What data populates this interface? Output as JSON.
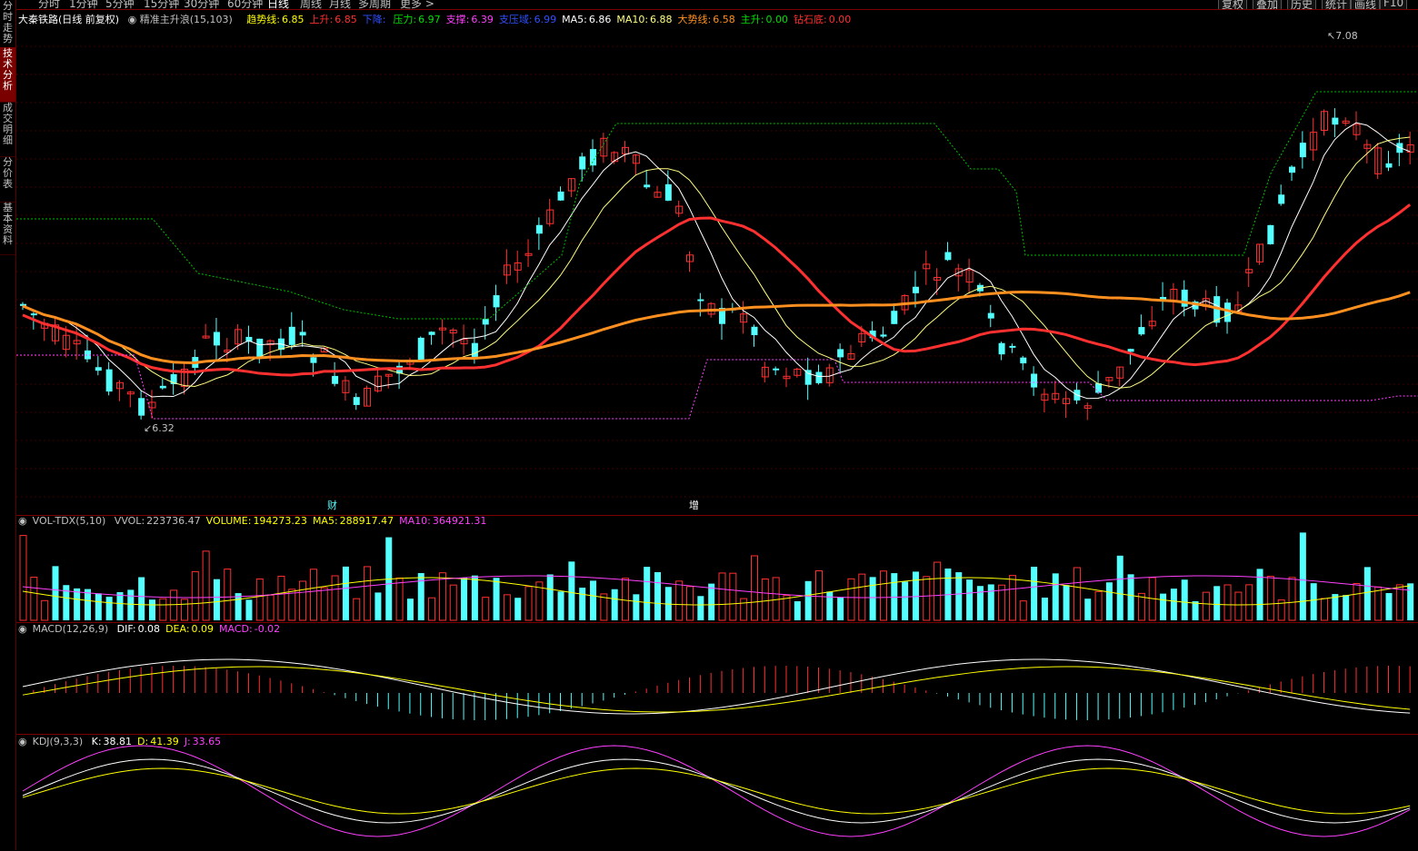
{
  "sidebar": {
    "tabs": [
      {
        "label": "分时走势",
        "active": false
      },
      {
        "label": "技术分析",
        "active": true
      },
      {
        "label": "成交明细",
        "active": false
      },
      {
        "label": "分价表",
        "active": false
      },
      {
        "label": "基本资料",
        "active": false
      }
    ]
  },
  "toolbar": {
    "periods": [
      "分时",
      "1分钟",
      "5分钟",
      "15分钟",
      "30分钟",
      "60分钟",
      "日线",
      "周线",
      "月线",
      "多周期",
      "更多 >"
    ],
    "active_period": "日线",
    "right_buttons": [
      "复权",
      "叠加",
      "历史",
      "统计",
      "画线",
      "F10"
    ]
  },
  "main_panel": {
    "stock": "大秦铁路(日线 前复权)",
    "indicator_name": "精准主升浪(15,103)",
    "values": [
      {
        "label": "趋势线:",
        "value": "6.85",
        "color": "#ffff00"
      },
      {
        "label": "上升:",
        "value": "6.85",
        "color": "#ff3030"
      },
      {
        "label": "下降:",
        "value": "",
        "color": "#3050ff"
      },
      {
        "label": "压力:",
        "value": "6.97",
        "color": "#00e000"
      },
      {
        "label": "支撑:",
        "value": "6.39",
        "color": "#ff40ff"
      },
      {
        "label": "支压域:",
        "value": "6.99",
        "color": "#3050ff"
      },
      {
        "label": "MA5:",
        "value": "6.86",
        "color": "#ffffff"
      },
      {
        "label": "MA10:",
        "value": "6.88",
        "color": "#ffff80"
      },
      {
        "label": "大势线:",
        "value": "6.58",
        "color": "#ff9020"
      },
      {
        "label": "主升:",
        "value": "0.00",
        "color": "#00e000"
      },
      {
        "label": "钻石底:",
        "value": "0.00",
        "color": "#ff3030"
      }
    ],
    "high_label": "7.08",
    "low_label": "6.32",
    "markers": [
      "财",
      "增"
    ]
  },
  "vol_panel": {
    "name": "VOL-TDX(5,10)",
    "values": [
      {
        "label": "VVOL:",
        "value": "223736.47",
        "color": "#c0c0c0"
      },
      {
        "label": "VOLUME:",
        "value": "194273.23",
        "color": "#ffff00"
      },
      {
        "label": "MA5:",
        "value": "288917.47",
        "color": "#ffff00"
      },
      {
        "label": "MA10:",
        "value": "364921.31",
        "color": "#ff40ff"
      }
    ]
  },
  "macd_panel": {
    "name": "MACD(12,26,9)",
    "values": [
      {
        "label": "DIF:",
        "value": "0.08",
        "color": "#ffffff"
      },
      {
        "label": "DEA:",
        "value": "0.09",
        "color": "#ffff00"
      },
      {
        "label": "MACD:",
        "value": "-0.02",
        "color": "#ff40ff"
      }
    ]
  },
  "kdj_panel": {
    "name": "KDJ(9,3,3)",
    "values": [
      {
        "label": "K:",
        "value": "38.81",
        "color": "#ffffff"
      },
      {
        "label": "D:",
        "value": "41.39",
        "color": "#ffff00"
      },
      {
        "label": "J:",
        "value": "33.65",
        "color": "#ff40ff"
      }
    ]
  },
  "colors": {
    "up": "#ff3030",
    "down": "#54ffff",
    "grid": "#7a0000",
    "background": "#000000"
  }
}
